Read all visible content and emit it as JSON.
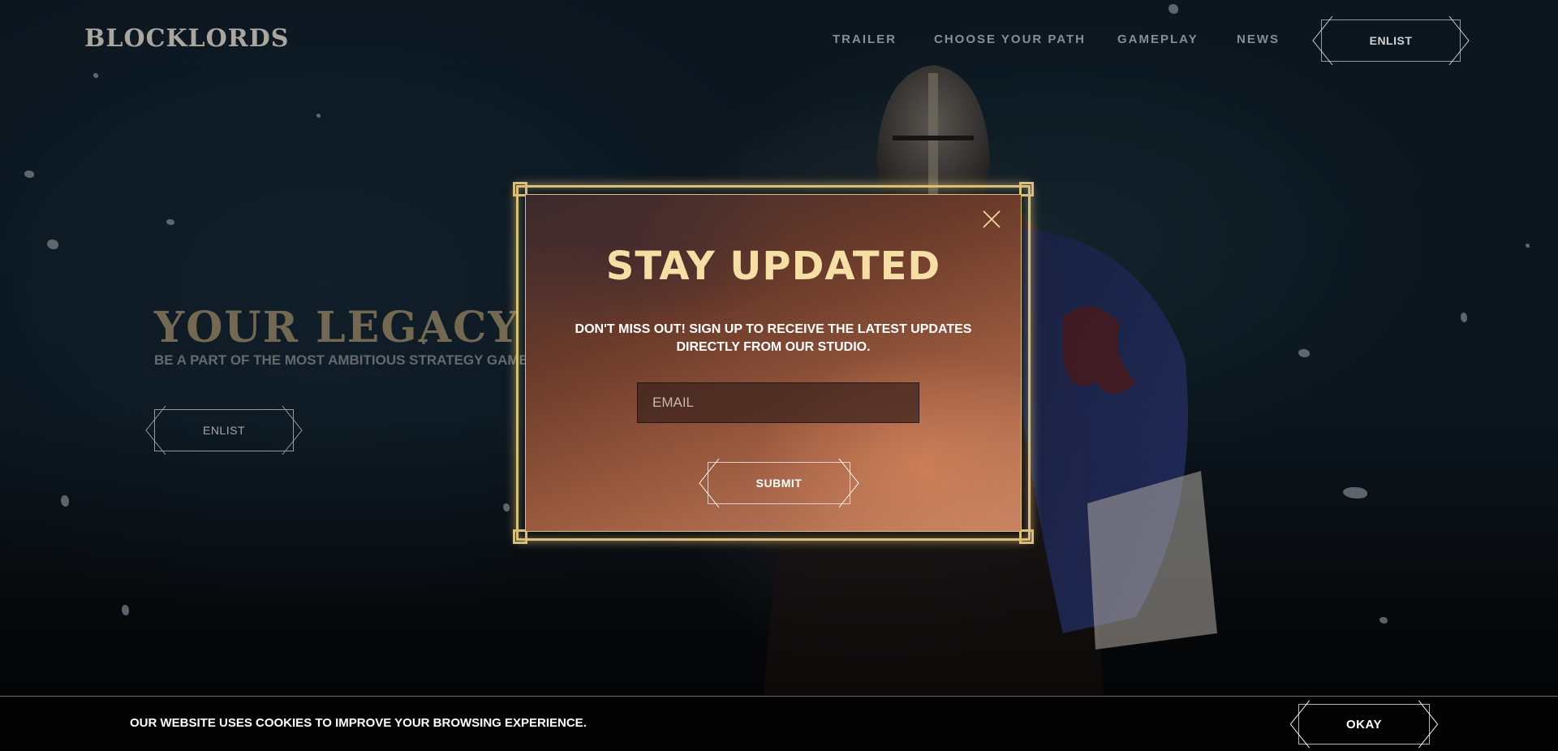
{
  "header": {
    "logo": "BLOCKLORDS",
    "nav": [
      "TRAILER",
      "CHOOSE YOUR PATH",
      "GAMEPLAY",
      "NEWS"
    ],
    "enlist_label": "ENLIST"
  },
  "hero": {
    "title": "YOUR LEGACY AWA",
    "subtitle": "BE A PART OF THE MOST AMBITIOUS STRATEGY GAME OF",
    "enlist_label": "ENLIST"
  },
  "modal": {
    "title": "STAY UPDATED",
    "description_line1": "DON'T MISS OUT! SIGN UP TO RECEIVE THE LATEST UPDATES",
    "description_line2": "DIRECTLY FROM OUR STUDIO.",
    "email_placeholder": "EMAIL",
    "submit_label": "SUBMIT"
  },
  "cookie": {
    "text": "OUR WEBSITE USES COOKIES TO IMPROVE YOUR BROWSING EXPERIENCE.",
    "okay_label": "OKAY"
  },
  "colors": {
    "gold": "#d9bf7e",
    "title_gold": "#f6dfa4",
    "hero_title": "#8d8064"
  }
}
